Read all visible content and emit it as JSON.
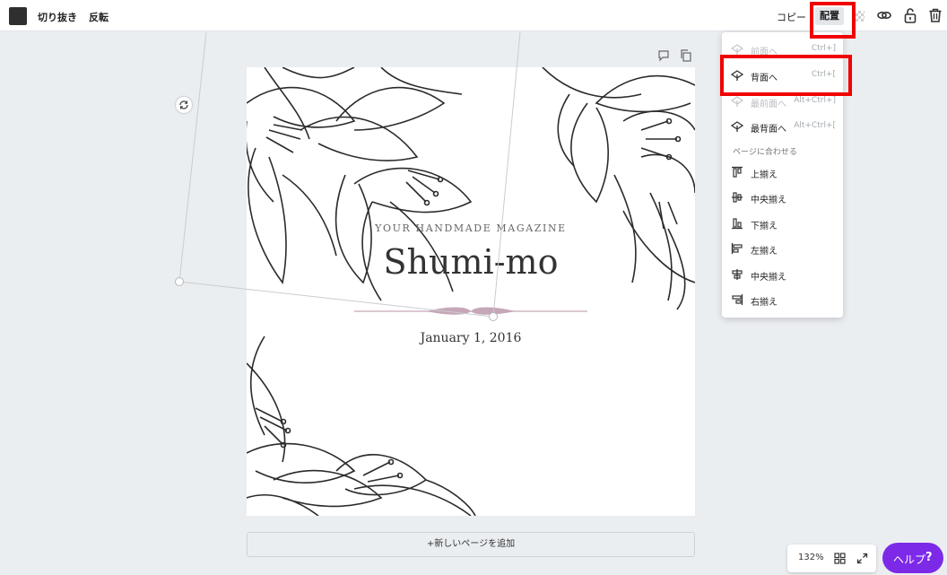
{
  "toolbar": {
    "crop_label": "切り抜き",
    "flip_label": "反転",
    "copy_label": "コピー",
    "arrange_label": "配置",
    "icons": [
      "transparency-icon",
      "link-icon",
      "lock-icon",
      "trash-icon"
    ]
  },
  "canvas": {
    "magazine_label": "YOUR HANDMADE MAGAZINE",
    "title": "Shumi-mo",
    "date": "January 1, 2016",
    "add_page_label": "+新しいページを追加"
  },
  "arrange_menu": {
    "items": [
      {
        "label": "前面へ",
        "shortcut": "Ctrl+]",
        "disabled": true
      },
      {
        "label": "背面へ",
        "shortcut": "Ctrl+[",
        "disabled": false
      },
      {
        "label": "最前面へ",
        "shortcut": "Alt+Ctrl+]",
        "disabled": true
      },
      {
        "label": "最背面へ",
        "shortcut": "Alt+Ctrl+[",
        "disabled": false
      }
    ],
    "section_label": "ページに合わせる",
    "align_items": [
      {
        "label": "上揃え"
      },
      {
        "label": "中央揃え"
      },
      {
        "label": "下揃え"
      },
      {
        "label": "左揃え"
      },
      {
        "label": "中央揃え"
      },
      {
        "label": "右揃え"
      }
    ]
  },
  "footer": {
    "zoom": "132%",
    "help_label": "ヘルプ",
    "help_icon": "?"
  },
  "colors": {
    "highlight": "#f00000",
    "help_button": "#7d2ae8",
    "canvas_bg": "#ebeef1"
  }
}
